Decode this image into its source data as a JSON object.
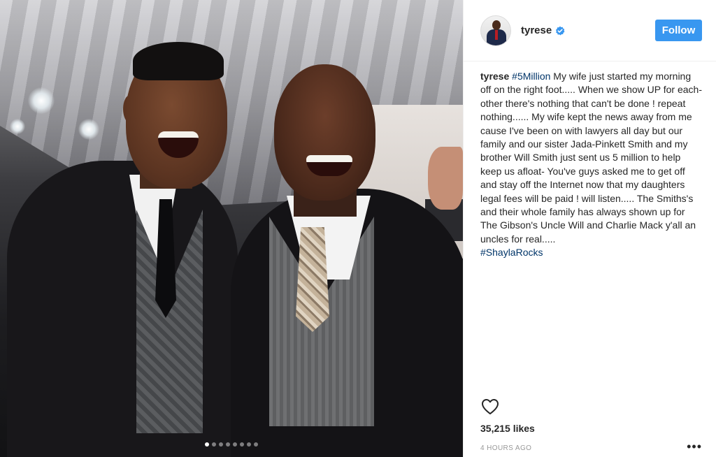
{
  "post": {
    "username": "tyrese",
    "verified": true,
    "follow_label": "Follow",
    "caption": {
      "user": "tyrese",
      "hashtag_start": "#5Million",
      "body": " My wife just started my morning off on the right foot..... When we show UP for each-other there's nothing that can't be done ! repeat nothing...... My wife kept the news away from me cause I've been on with lawyers all day but our family and our sister Jada-Pinkett Smith and my brother Will Smith just sent us 5 million to help keep us afloat- You've guys asked me to get off and stay off the Internet now that my daughters legal fees will be paid ! will listen..... The Smiths's and their whole family has always shown up for The Gibson's Uncle Will and Charlie Mack y'all an uncles for real.....",
      "hashtag_end": "#ShaylaRocks"
    },
    "likes": "35,215 likes",
    "time": "4 HOURS AGO",
    "more_label": "•••",
    "carousel": {
      "count": 8,
      "active_index": 0
    }
  },
  "icons": {
    "verified": "verified-badge-icon",
    "heart": "heart-outline-icon",
    "more": "more-options-icon"
  },
  "colors": {
    "follow_button": "#3897f0",
    "hashtag": "#003569",
    "verified": "#3897f0",
    "muted": "#999999"
  }
}
